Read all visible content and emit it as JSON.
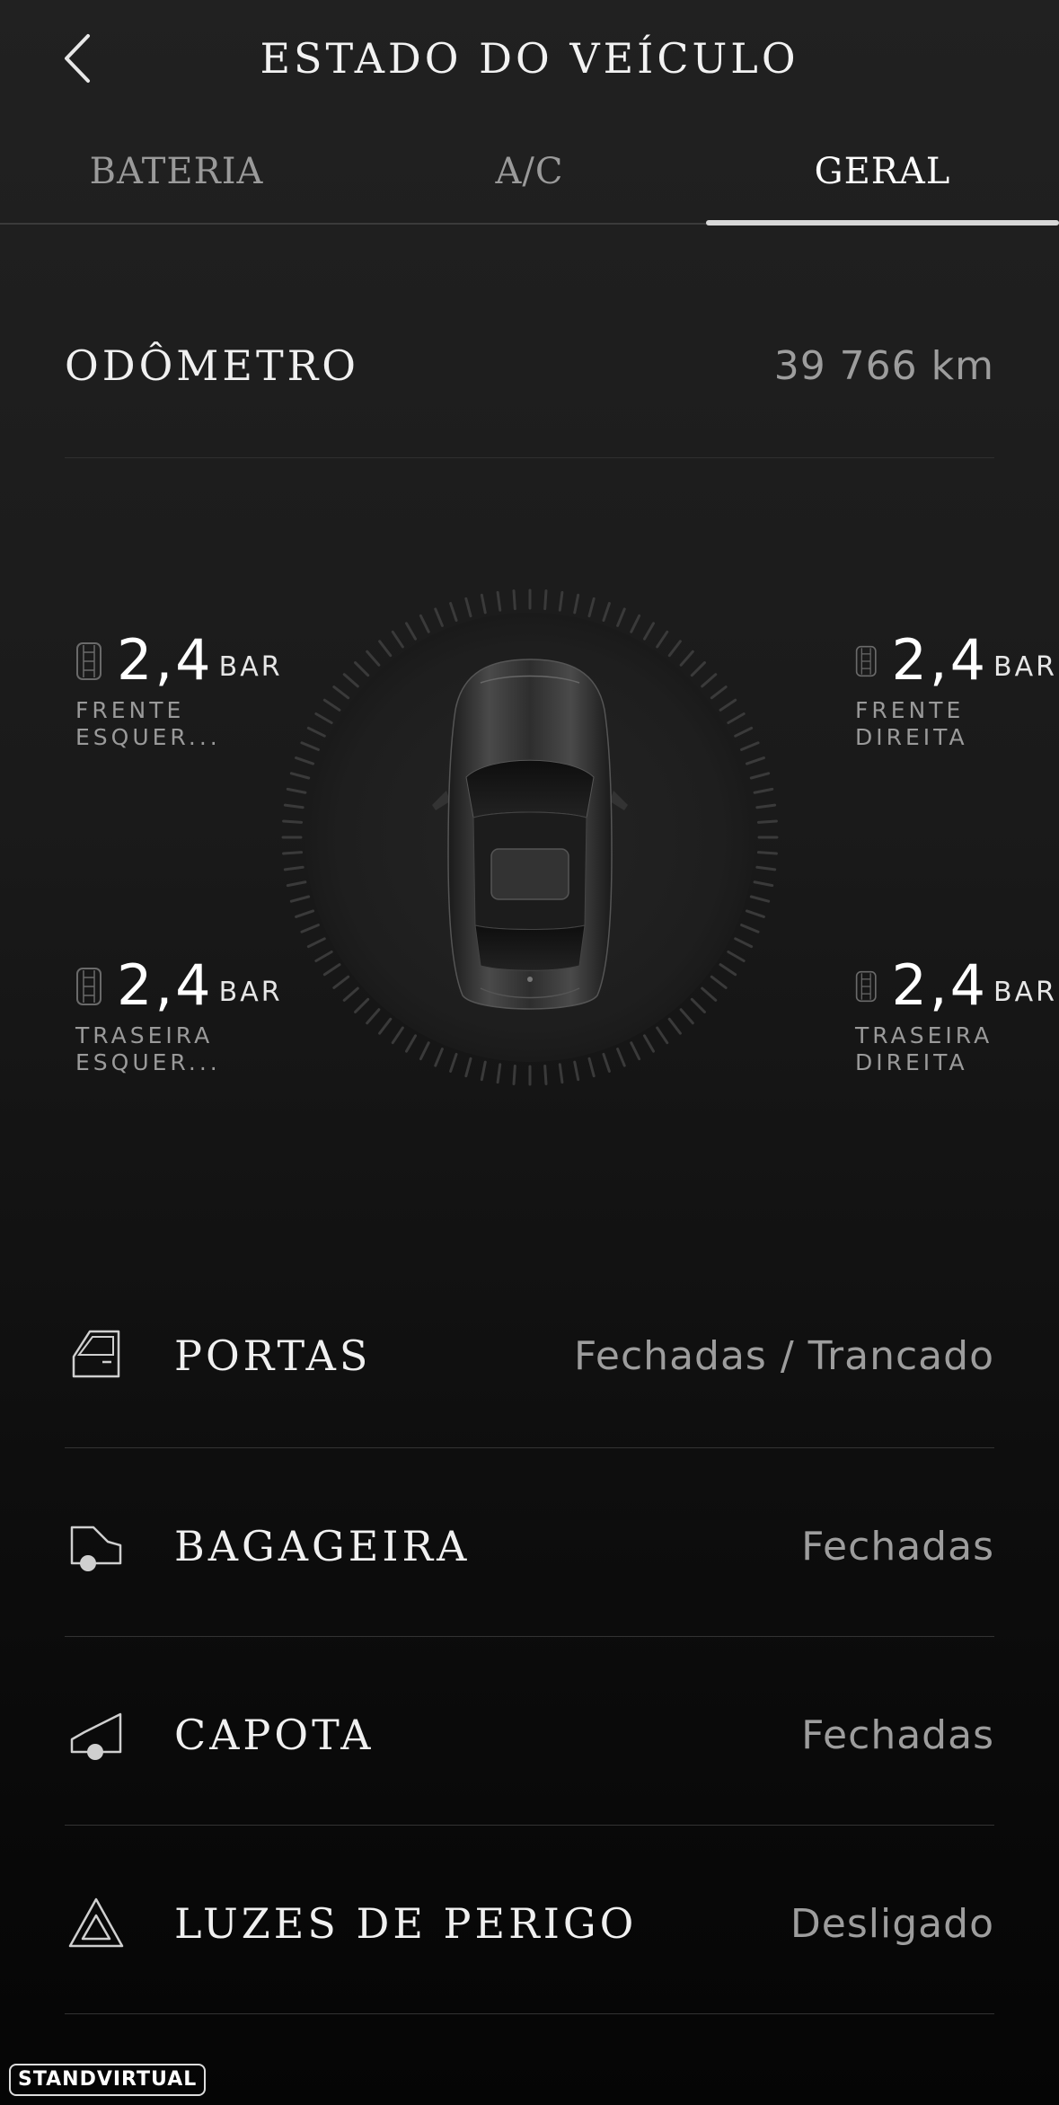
{
  "header": {
    "title": "ESTADO DO VEÍCULO",
    "back_icon": "chevron-left-icon"
  },
  "tabs": [
    {
      "label": "BATERIA",
      "active": false
    },
    {
      "label": "A/C",
      "active": false
    },
    {
      "label": "GERAL",
      "active": true
    }
  ],
  "odometer": {
    "label": "ODÔMETRO",
    "value": "39 766 km"
  },
  "tires": {
    "front_left": {
      "value": "2,4",
      "unit": "BAR",
      "label": "FRENTE ESQUER..."
    },
    "front_right": {
      "value": "2,4",
      "unit": "BAR",
      "label": "FRENTE DIREITA"
    },
    "rear_left": {
      "value": "2,4",
      "unit": "BAR",
      "label": "TRASEIRA ESQUER..."
    },
    "rear_right": {
      "value": "2,4",
      "unit": "BAR",
      "label": "TRASEIRA DIREITA"
    }
  },
  "status": [
    {
      "icon": "door-icon",
      "label": "PORTAS",
      "value": "Fechadas / Trancado"
    },
    {
      "icon": "trunk-icon",
      "label": "BAGAGEIRA",
      "value": "Fechadas"
    },
    {
      "icon": "hood-icon",
      "label": "CAPOTA",
      "value": "Fechadas"
    },
    {
      "icon": "hazard-icon",
      "label": "LUZES DE PERIGO",
      "value": "Desligado"
    }
  ],
  "watermark": "STANDVIRTUAL",
  "colors": {
    "background": "#1b1b1b",
    "text_primary": "#ffffff",
    "text_secondary": "#9d9d9d",
    "active_tab_indicator": "#d8d8d8"
  }
}
